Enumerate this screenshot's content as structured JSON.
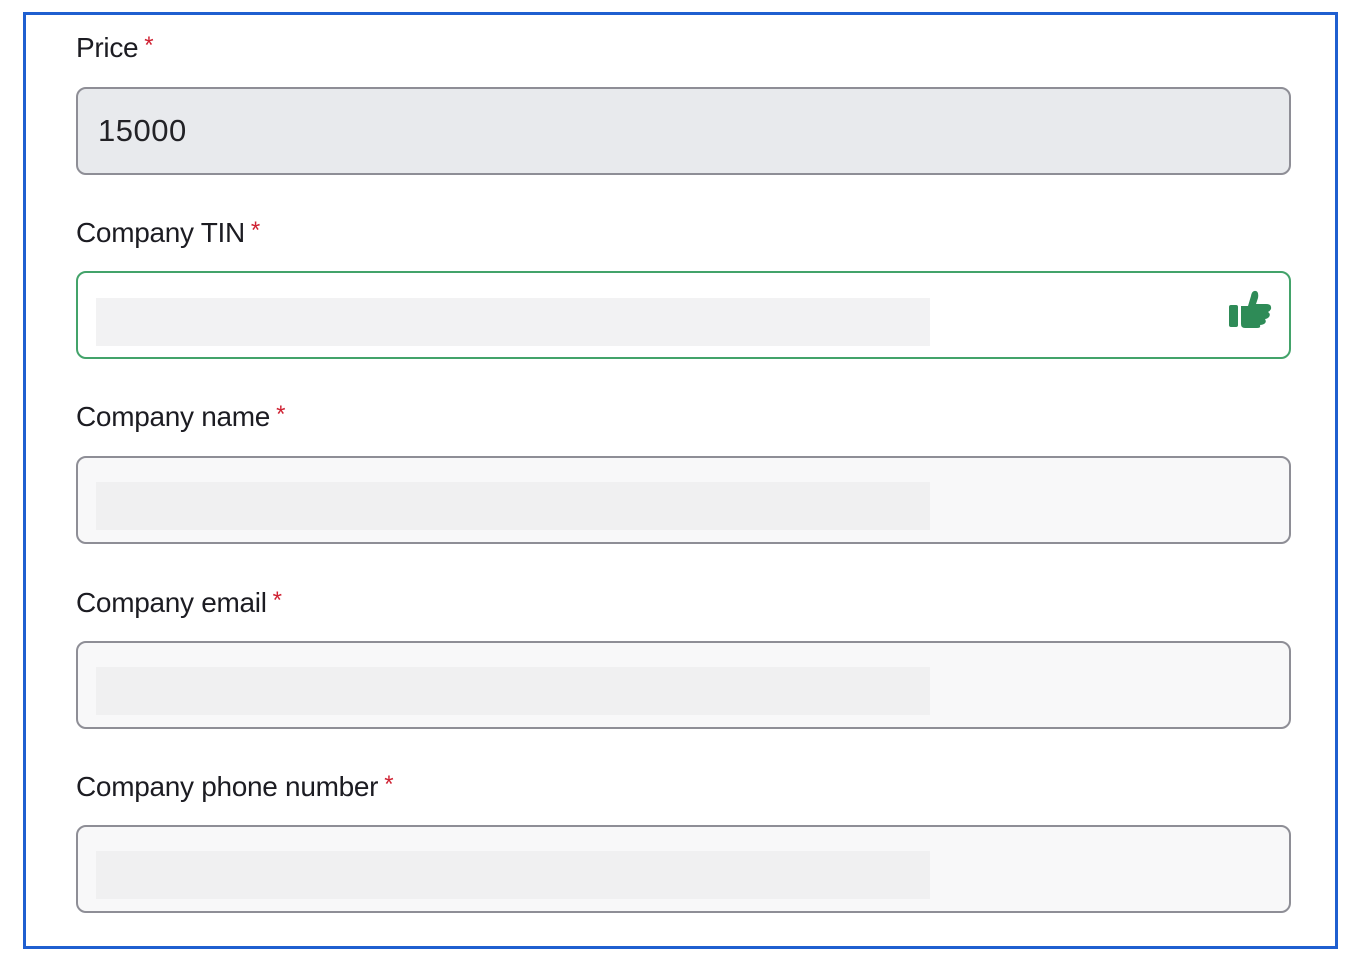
{
  "colors": {
    "frame_border": "#1f5fd0",
    "required_asterisk": "#cf2233",
    "valid_border": "#43a36a",
    "valid_icon": "#2e8b57"
  },
  "form": {
    "price": {
      "label": "Price",
      "required_mark": "*",
      "value": "15000",
      "state": "readonly"
    },
    "company_tin": {
      "label": "Company TIN",
      "required_mark": "*",
      "value": "",
      "state": "valid",
      "status_icon": "thumbs-up-icon"
    },
    "company_name": {
      "label": "Company name",
      "required_mark": "*",
      "value": ""
    },
    "company_email": {
      "label": "Company email",
      "required_mark": "*",
      "value": ""
    },
    "company_phone": {
      "label": "Company phone number",
      "required_mark": "*",
      "value": ""
    }
  }
}
